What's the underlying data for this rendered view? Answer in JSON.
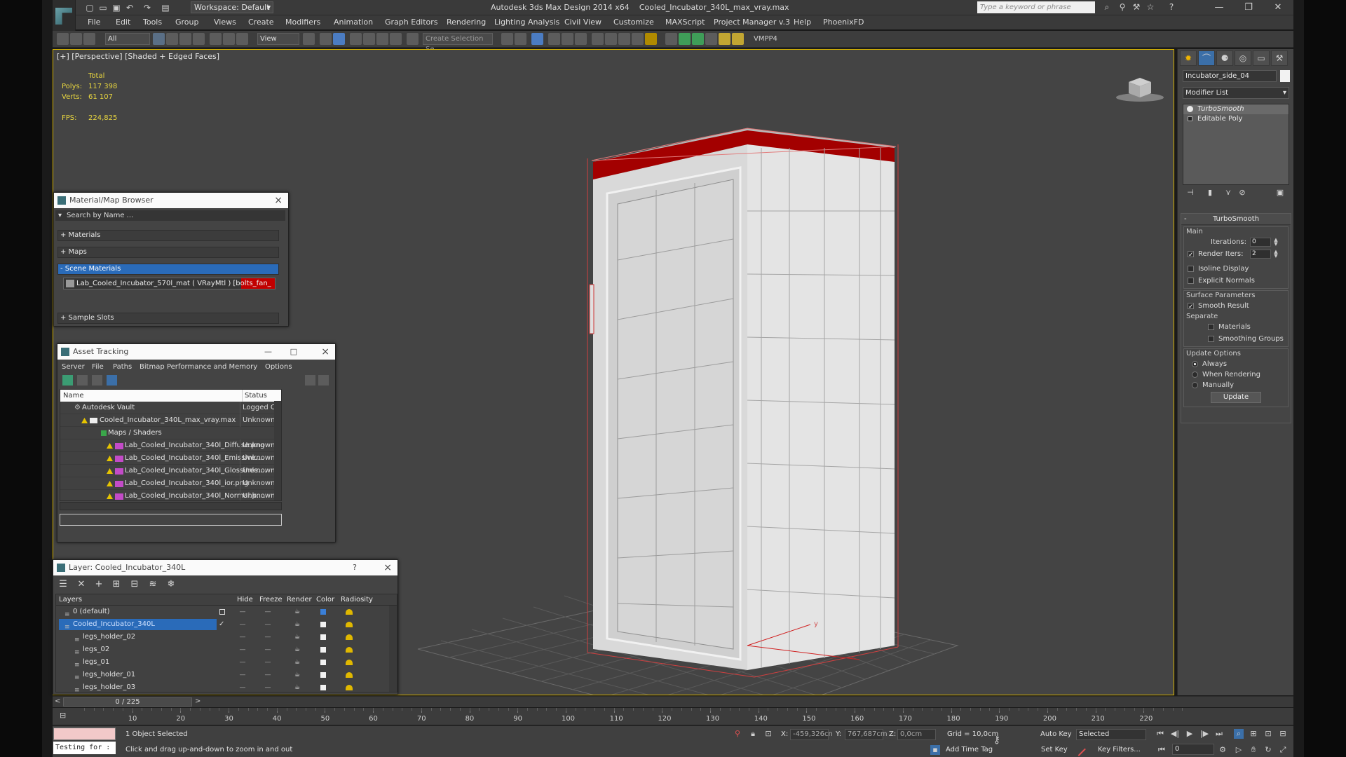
{
  "app": {
    "title": "Autodesk 3ds Max Design 2014 x64",
    "file": "Cooled_Incubator_340L_max_vray.max",
    "logo_text": "MAX",
    "workspace": "Workspace: Default",
    "search_placeholder": "Type a keyword or phrase"
  },
  "menu": [
    "File",
    "Edit",
    "Tools",
    "Group",
    "Views",
    "Create",
    "Modifiers",
    "Animation",
    "Graph Editors",
    "Rendering",
    "Lighting Analysis",
    "Civil View",
    "Customize",
    "MAXScript",
    "Project Manager v.3",
    "Help",
    "PhoenixFD"
  ],
  "toolbar": {
    "selection_filter": "All",
    "ref_coord": "View",
    "named_selection": "Create Selection Se",
    "vmpp": "VMPP4"
  },
  "viewport": {
    "label": "[+] [Perspective] [Shaded + Edged Faces]",
    "stats": {
      "header": "Total",
      "polys_label": "Polys:",
      "polys": "117 398",
      "verts_label": "Verts:",
      "verts": "61 107",
      "fps_label": "FPS:",
      "fps": "224,825"
    },
    "axis_y": "y"
  },
  "command_panel": {
    "object_name": "Incubator_side_04",
    "modifier_list": "Modifier List",
    "stack": [
      "TurboSmooth",
      "Editable Poly"
    ],
    "turbosmooth": {
      "title": "TurboSmooth",
      "main": "Main",
      "iterations_label": "Iterations:",
      "iterations": "0",
      "render_iters_label": "Render Iters:",
      "render_iters": "2",
      "isoline": "Isoline Display",
      "explicit": "Explicit Normals",
      "surface_params": "Surface Parameters",
      "smooth_result": "Smooth Result",
      "separate": "Separate",
      "materials": "Materials",
      "smoothing_groups": "Smoothing Groups",
      "update_options": "Update Options",
      "always": "Always",
      "when_rendering": "When Rendering",
      "manually": "Manually",
      "update_btn": "Update"
    }
  },
  "material_browser": {
    "title": "Material/Map Browser",
    "search": "Search by Name ...",
    "sections": [
      "+ Materials",
      "+ Maps",
      "- Scene Materials",
      "+ Sample Slots"
    ],
    "scene_item": "Lab_Cooled_Incubator_570l_mat ( VRayMtl ) [bolts_fan_"
  },
  "asset_tracking": {
    "title": "Asset Tracking",
    "menu": [
      "Server",
      "File",
      "Paths",
      "Bitmap Performance and Memory",
      "Options"
    ],
    "col_name": "Name",
    "col_status": "Status",
    "rows": [
      {
        "name": "Autodesk Vault",
        "status": "Logged Out"
      },
      {
        "name": "Cooled_Incubator_340L_max_vray.max",
        "status": "Unknown St"
      },
      {
        "name": "Maps / Shaders",
        "status": ""
      },
      {
        "name": "Lab_Cooled_Incubator_340l_Diffuse.png",
        "status": "Unknown St"
      },
      {
        "name": "Lab_Cooled_Incubator_340l_Emissive....",
        "status": "Unknown St"
      },
      {
        "name": "Lab_Cooled_Incubator_340l_Glossines....",
        "status": "Unknown St"
      },
      {
        "name": "Lab_Cooled_Incubator_340l_ior.png",
        "status": "Unknown St"
      },
      {
        "name": "Lab_Cooled_Incubator_340l_Normal.p....",
        "status": "Unknown St"
      }
    ]
  },
  "layers": {
    "title": "Layer: Cooled_Incubator_340L",
    "help": "?",
    "cols": [
      "Layers",
      "Hide",
      "Freeze",
      "Render",
      "Color",
      "Radiosity"
    ],
    "rows": [
      "0 (default)",
      "Cooled_Incubator_340L",
      "legs_holder_02",
      "legs_02",
      "legs_01",
      "legs_holder_01",
      "legs_holder_03"
    ],
    "colors": [
      "#3a7fd8",
      "#f2f2f2",
      "#f2f2f2",
      "#f2f2f2",
      "#f2f2f2",
      "#f2f2f2",
      "#f2f2f2"
    ]
  },
  "timeline": {
    "frame": "0 / 225",
    "ticks": [
      "10",
      "20",
      "30",
      "40",
      "50",
      "60",
      "70",
      "80",
      "90",
      "100",
      "110",
      "120",
      "130",
      "140",
      "150",
      "160",
      "170",
      "180",
      "190",
      "200",
      "210",
      "220"
    ]
  },
  "status": {
    "maxscript": "Testing for :",
    "selected": "1 Object Selected",
    "prompt": "Click and drag up-and-down to zoom in and out",
    "x_label": "X:",
    "x": "-459,326cn",
    "y_label": "Y:",
    "y": "767,687cm",
    "z_label": "Z:",
    "z": "0,0cm",
    "grid": "Grid = 10,0cm",
    "add_time_tag": "Add Time Tag",
    "auto_key": "Auto Key",
    "set_key": "Set Key",
    "selected_dd": "Selected",
    "key_filters": "Key Filters...",
    "frame_field": "0"
  }
}
